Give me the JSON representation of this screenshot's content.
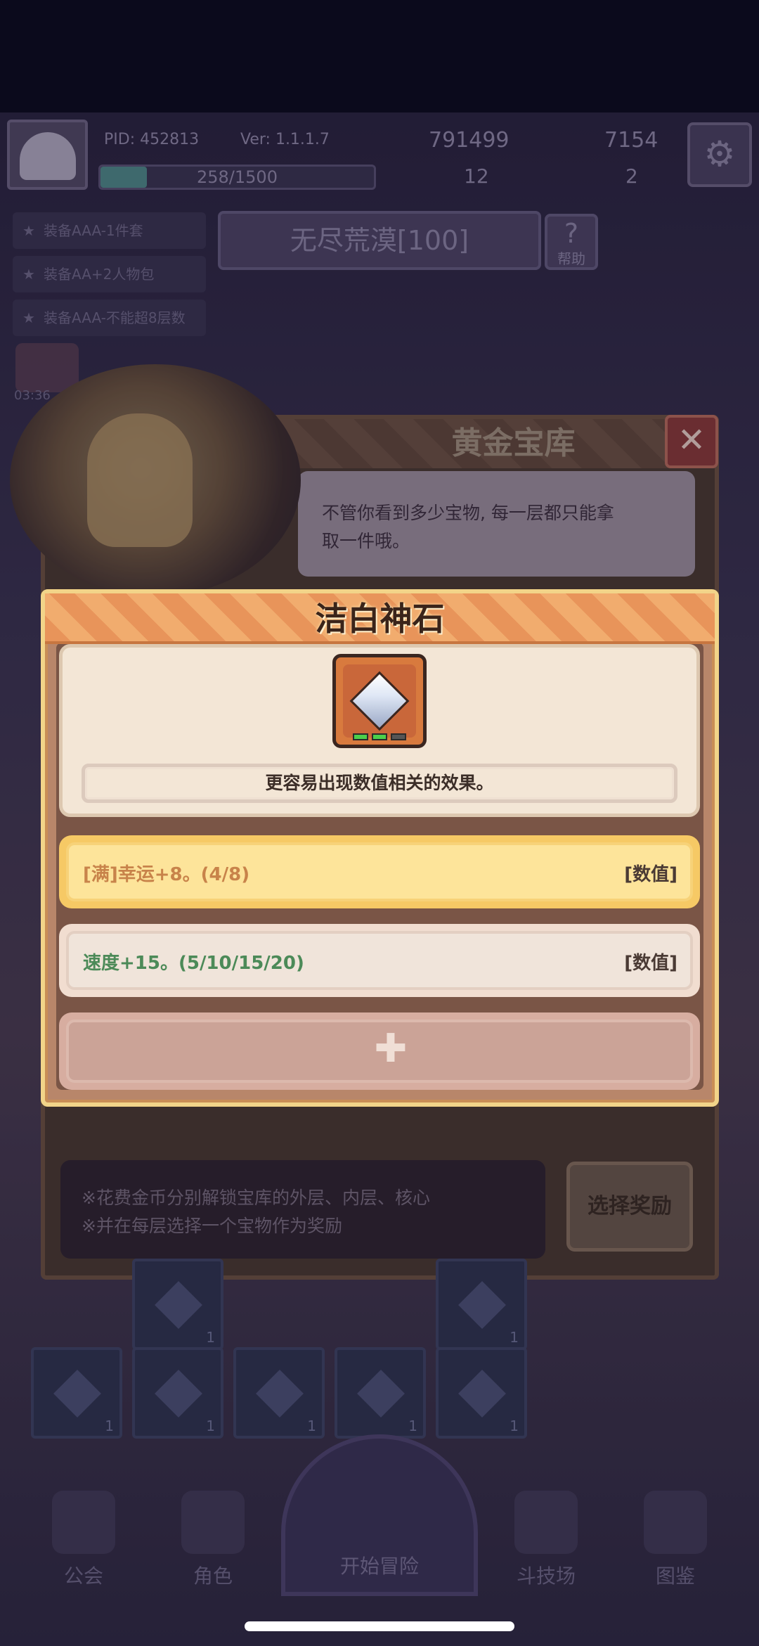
{
  "hud": {
    "pid": "PID: 452813",
    "version": "Ver: 1.1.1.7",
    "gold": "791499",
    "gems": "7154",
    "xp": "258/1500",
    "xp_progress": 0.17,
    "clover": "12",
    "keys": "2"
  },
  "quests": [
    "装备AAA-1件套",
    "装备AA+2人物包",
    "装备AAA-不能超8层数"
  ],
  "stage": {
    "title": "无尽荒漠[100]",
    "help": "帮助"
  },
  "timer": "03:36",
  "vault": {
    "title": "黄金宝库",
    "close": "✕",
    "bubble_line1": "不管你看到多少宝物, 每一层都只能拿",
    "bubble_line2": "取一件哦。",
    "footer_line1": "※花费金币分别解锁宝库的外层、内层、核心",
    "footer_line2": "※并在每层选择一个宝物作为奖励",
    "choose_button": "选择奖励"
  },
  "slots": [
    {
      "count": "1"
    },
    {
      "count": "1"
    },
    {
      "count": "1"
    },
    {
      "count": "1"
    },
    {
      "count": "1"
    },
    {
      "count": "1"
    },
    {
      "count": "1"
    }
  ],
  "nav": {
    "guild": "公会",
    "role": "角色",
    "start": "开始冒险",
    "arena": "斗技场",
    "codex": "图鉴"
  },
  "modal": {
    "title": "洁白神石",
    "description": "更容易出现数值相关的效果。",
    "affixes": [
      {
        "text": "[满]幸运+8。(4/8)",
        "tag": "[数值]",
        "style": "gold"
      },
      {
        "text": "速度+15。(5/10/15/20)",
        "tag": "[数值]",
        "style": "plain"
      }
    ],
    "empty_slot_icon": "plus-icon"
  },
  "colors": {
    "modal_header": "#e8945a",
    "gold_affix": "#fde49a",
    "gold_affix_text": "#c8834a",
    "green_affix_text": "#4c8a58"
  }
}
